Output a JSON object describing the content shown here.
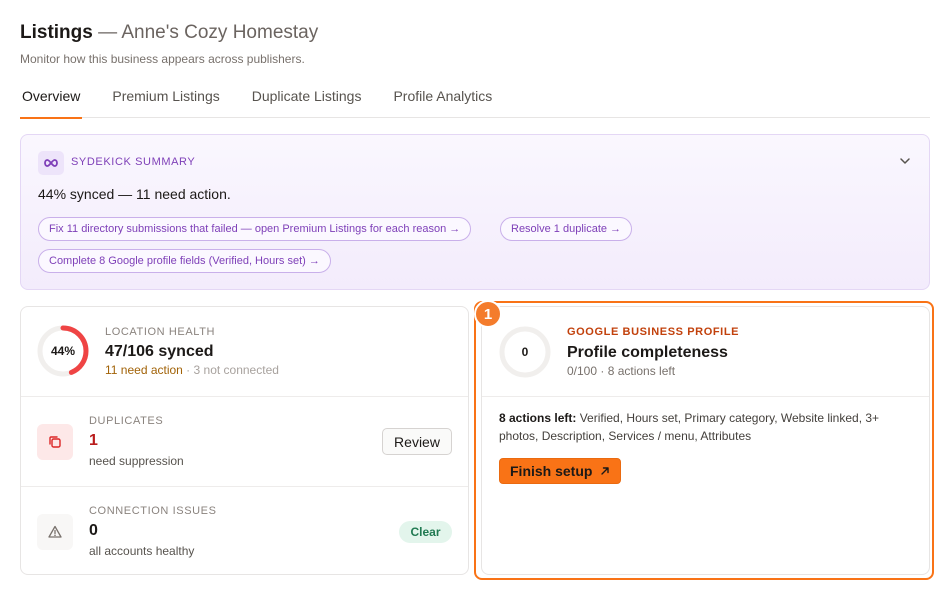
{
  "header": {
    "title": "Listings",
    "separator": " — ",
    "business_name": "Anne's Cozy Homestay",
    "subtitle": "Monitor how this business appears across publishers."
  },
  "tabs": [
    {
      "label": "Overview",
      "active": true
    },
    {
      "label": "Premium Listings",
      "active": false
    },
    {
      "label": "Duplicate Listings",
      "active": false
    },
    {
      "label": "Profile Analytics",
      "active": false
    }
  ],
  "summary": {
    "label": "SYDEKICK SUMMARY",
    "text": "44% synced — 11 need action.",
    "chips": [
      "Fix 11 directory submissions that failed — open Premium Listings for each reason →",
      "Resolve 1 duplicate →",
      "Complete 8 Google profile fields (Verified, Hours set) →"
    ],
    "accent_color": "#7e3fb8"
  },
  "location_health": {
    "label": "LOCATION HEALTH",
    "percent_text": "44%",
    "percent_value": 44,
    "synced_text": "47/106 synced",
    "need_action": "11 need action",
    "separator": " · ",
    "not_connected": "3 not connected",
    "ring_color": "#ef4444"
  },
  "duplicates": {
    "label": "DUPLICATES",
    "count": "1",
    "caption": "need suppression",
    "button_label": "Review"
  },
  "connection_issues": {
    "label": "CONNECTION ISSUES",
    "count": "0",
    "caption": "all accounts healthy",
    "badge_label": "Clear"
  },
  "google_profile": {
    "marker": "1",
    "label": "GOOGLE BUSINESS PROFILE",
    "ring_text": "0",
    "ring_value": 0,
    "title": "Profile completeness",
    "subtitle": "0/100 · 8 actions left",
    "actions_lead": "8 actions left:",
    "actions_list": "Verified, Hours set, Primary category, Website linked, 3+ photos, Description, Services / menu, Attributes",
    "button_label": "Finish setup",
    "accent_color": "#f97316"
  }
}
